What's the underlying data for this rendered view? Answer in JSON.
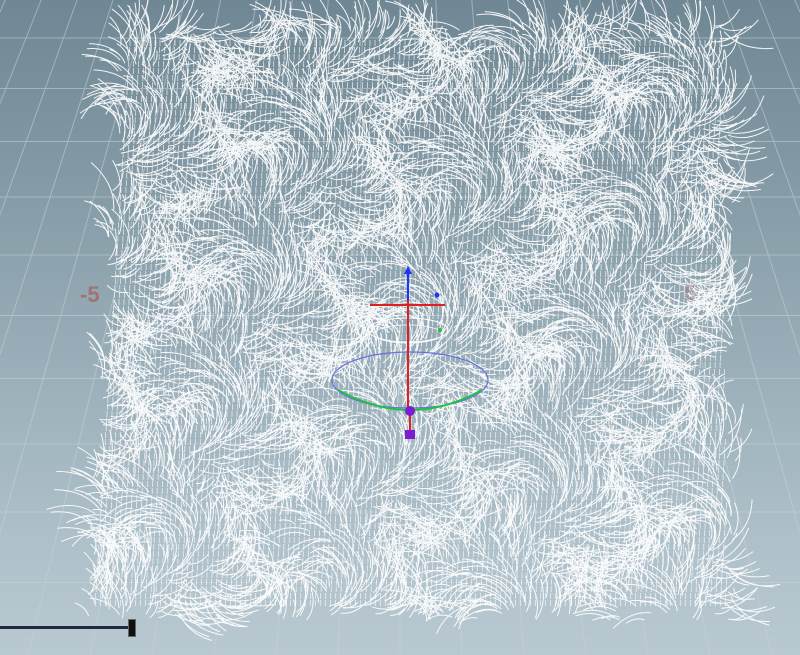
{
  "viewport": {
    "axis_labels": {
      "negative": "-5",
      "positive": "5"
    },
    "colors": {
      "background_top": "#6f8794",
      "background_bottom": "#b9c9d1",
      "grid": "#c7d3d9",
      "hair": "#ffffff",
      "gizmo_x": "#e02020",
      "gizmo_y": "#2030ff",
      "gizmo_z": "#20c040",
      "handle": "#7a1fd0"
    },
    "icons": [
      "transform-gizmo-icon",
      "rotate-ring-icon",
      "pivot-handle-icon"
    ]
  },
  "timeline": {
    "name": "timeline-scrubber"
  }
}
